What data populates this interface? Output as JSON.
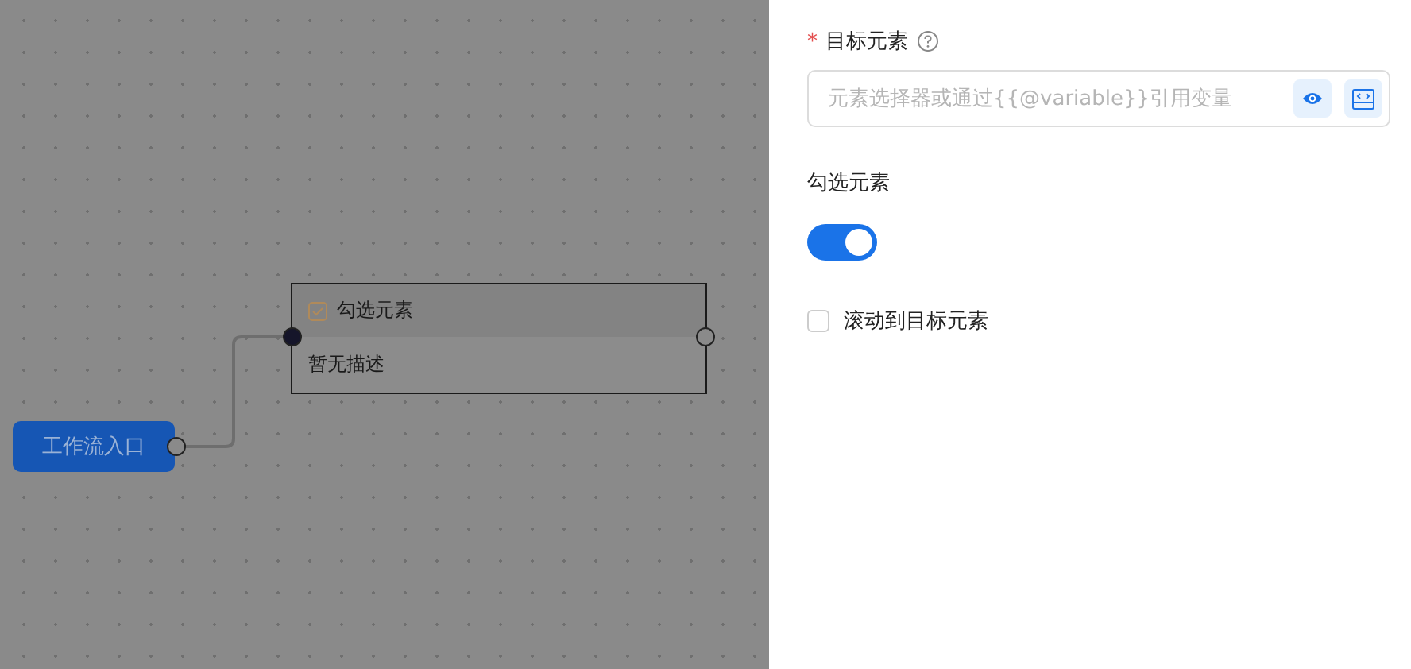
{
  "canvas": {
    "nodes": [
      {
        "kind": "entry",
        "label": "工作流入口"
      },
      {
        "kind": "action",
        "title": "勾选元素",
        "description": "暂无描述"
      }
    ]
  },
  "panel": {
    "target": {
      "label": "目标元素",
      "required_mark": "*",
      "placeholder": "元素选择器或通过{{@variable}}引用变量"
    },
    "toggle": {
      "label": "勾选元素",
      "on": true
    },
    "checkbox": {
      "label": "滚动到目标元素",
      "checked": false
    }
  }
}
